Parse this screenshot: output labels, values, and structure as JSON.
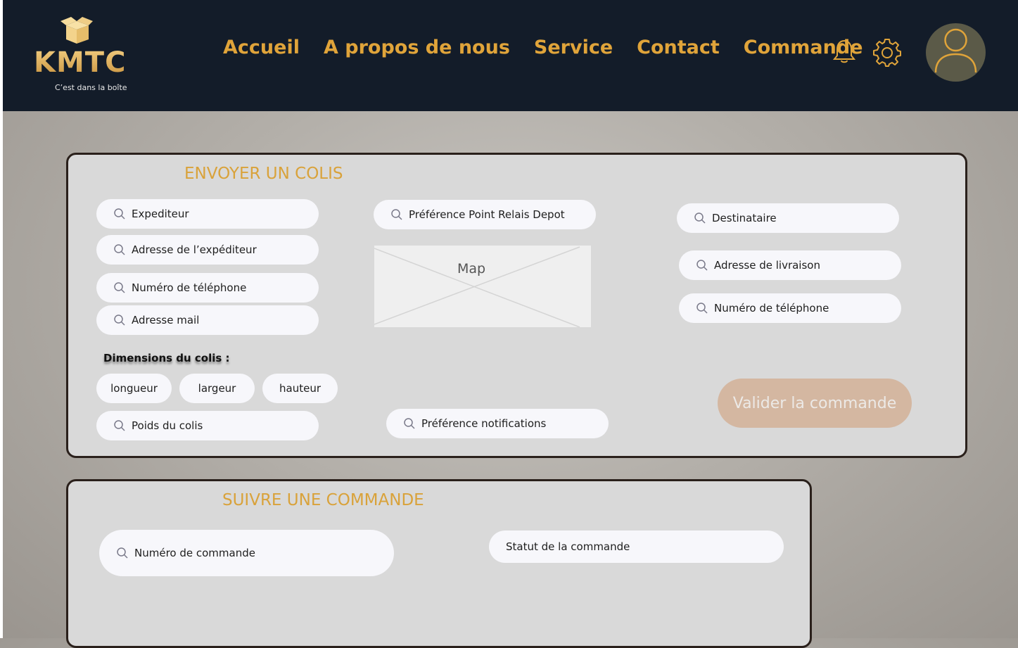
{
  "brand": {
    "name": "KMTC",
    "tagline": "C’est dans la boîte"
  },
  "nav": {
    "items": [
      {
        "label": "Accueil"
      },
      {
        "label": "A propos de nous"
      },
      {
        "label": "Service"
      },
      {
        "label": "Contact"
      },
      {
        "label": "Commande"
      }
    ]
  },
  "send": {
    "title": "ENVOYER UN COLIS",
    "sender_placeholder": "Expediteur",
    "sender_address_placeholder": "Adresse de l’expéditeur",
    "sender_phone_placeholder": "Numéro de téléphone",
    "sender_email_placeholder": "Adresse mail",
    "dimensions_label": "Dimensions du colis :",
    "length_label": "longueur",
    "width_label": "largeur",
    "height_label": "hauteur",
    "weight_placeholder": "Poids du colis",
    "relay_placeholder": "Préférence Point Relais Depot",
    "map_label": "Map",
    "notifications_placeholder": "Préférence notifications",
    "recipient_placeholder": "Destinataire",
    "delivery_address_placeholder": "Adresse de livraison",
    "recipient_phone_placeholder": "Numéro de téléphone",
    "submit_label": "Valider la commande"
  },
  "track": {
    "title": "SUIVRE UNE COMMANDE",
    "order_number_placeholder": "Numéro de commande",
    "status_label": "Statut de la commande"
  },
  "colors": {
    "header_bg": "#131c29",
    "accent": "#e0a43a",
    "panel_bg": "#d9d9d9",
    "button_bg": "#d4b7a1"
  },
  "icons": [
    "box-icon",
    "bell-icon",
    "gear-icon",
    "user-icon",
    "search-icon"
  ]
}
